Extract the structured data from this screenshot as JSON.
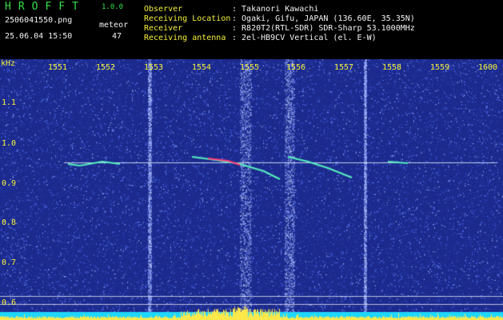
{
  "app": {
    "logo": "HROFFT",
    "version": "1.0.0"
  },
  "file": {
    "name": "2506041550.png",
    "datetime": "25.06.04 15:50"
  },
  "detection": {
    "label": "meteor",
    "count": "47"
  },
  "info": [
    {
      "key": "Observer",
      "value": ": Takanori Kawachi"
    },
    {
      "key": "Receiving Location",
      "value": ": Ogaki, Gifu, JAPAN (136.60E, 35.35N)"
    },
    {
      "key": "Receiver",
      "value": ": R820T2(RTL-SDR) SDR-Sharp 53.1000MHz"
    },
    {
      "key": "Receiving antenna",
      "value": ": 2el-HB9CV Vertical (el. E-W)"
    }
  ],
  "x_ticks": [
    "1551",
    "1552",
    "1553",
    "1554",
    "1555",
    "1556",
    "1557",
    "1558",
    "1559",
    "1600"
  ],
  "y_unit": "kHz",
  "y_ticks": [
    "1.1",
    "1.0",
    "0.9",
    "0.8",
    "0.7",
    "0.6"
  ],
  "colors": {
    "background": "#1b2a8c",
    "noise": "#5a78ff",
    "trace": "#ffffff",
    "axis": "#f6f13a",
    "logo": "#31e04a"
  }
}
